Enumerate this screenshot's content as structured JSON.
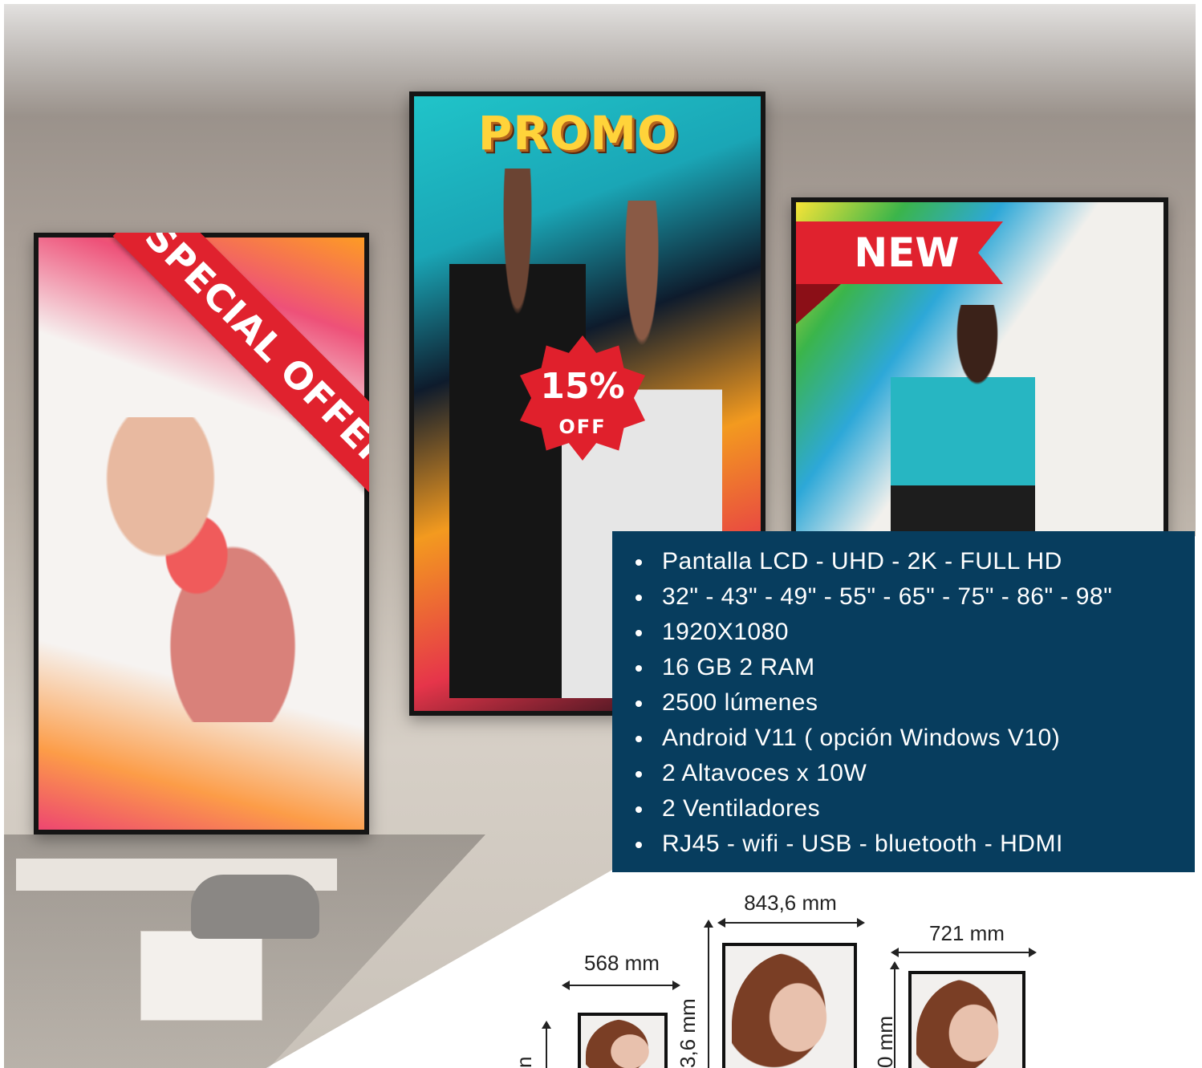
{
  "screens": {
    "left": {
      "ribbon": "SPECIAL OFFER"
    },
    "middle": {
      "title": "PROMO",
      "badge_percent": "15%",
      "badge_off": "OFF"
    },
    "right": {
      "ribbon": "NEW"
    }
  },
  "specs": [
    "Pantalla LCD - UHD - 2K - FULL HD",
    "32\" - 43\" - 49\" - 55\" - 65\" - 75\" - 86\" - 98\"",
    "1920X1080",
    "16 GB 2 RAM",
    "2500 lúmenes",
    "Android V11 ( opción Windows V10)",
    "2 Altavoces x 10W",
    "2 Ventiladores",
    "RJ45 - wifi - USB - bluetooth - HDMI"
  ],
  "dimensions": {
    "small_width": "568 mm",
    "large_width": "843,6 mm",
    "large_height_partial": "3,6 mm",
    "medium_width": "721 mm",
    "medium_height_partial": "0 mm",
    "small_height_partial": "n"
  },
  "colors": {
    "panel_bg": "#073d5e",
    "ribbon_red": "#e0222e",
    "promo_yellow": "#ffd33a"
  }
}
